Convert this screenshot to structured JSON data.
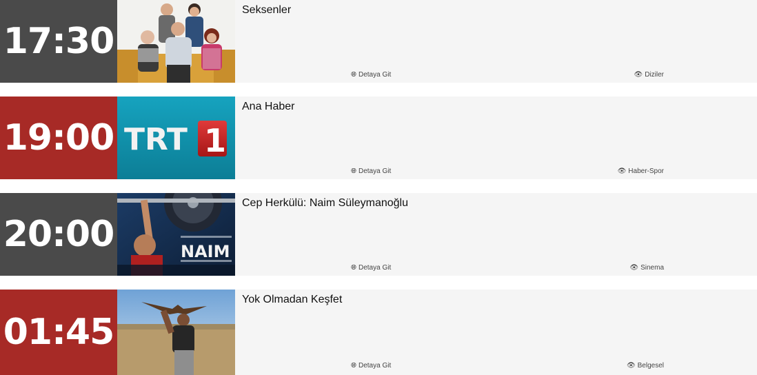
{
  "colors": {
    "time_gray": "#4a4a4a",
    "time_red": "#a72a26",
    "row_bg": "#f5f5f5"
  },
  "programs": [
    {
      "time": "17:30",
      "title": "Seksenler",
      "details_label": "Detaya Git",
      "category": "Diziler",
      "time_color": "gray",
      "thumbnail": "family-sitcom-photo"
    },
    {
      "time": "19:00",
      "title": "Ana Haber",
      "details_label": "Detaya Git",
      "category": "Haber-Spor",
      "time_color": "red",
      "thumbnail": "trt1-logo",
      "logo_text": "TRT",
      "logo_number": "1"
    },
    {
      "time": "20:00",
      "title": "Cep Herkülü: Naim Süleymanoğlu",
      "details_label": "Detaya Git",
      "category": "Sinema",
      "time_color": "gray",
      "thumbnail": "weightlifter-poster",
      "poster_text": "NAIM"
    },
    {
      "time": "01:45",
      "title": "Yok Olmadan Keşfet",
      "details_label": "Detaya Git",
      "category": "Belgesel",
      "time_color": "red",
      "thumbnail": "eagle-falconer-photo"
    }
  ],
  "icons": {
    "details": "globe-icon",
    "category": "eye-icon"
  }
}
